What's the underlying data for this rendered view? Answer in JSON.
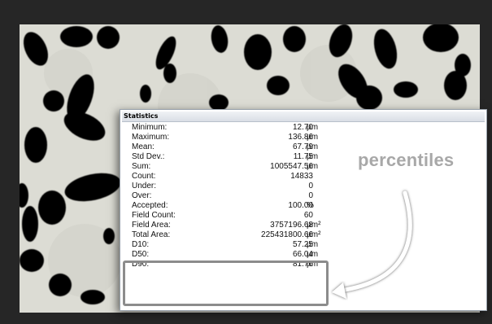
{
  "panel": {
    "title": "Statistics",
    "rows": [
      {
        "label": "Minimum:",
        "value": "12.70",
        "unit": "µm"
      },
      {
        "label": "Maximum:",
        "value": "136.86",
        "unit": "µm"
      },
      {
        "label": "Mean:",
        "value": "67.79",
        "unit": "µm"
      },
      {
        "label": "Std Dev.:",
        "value": "11.75",
        "unit": "µm"
      },
      {
        "label": "Sum:",
        "value": "1005547.56",
        "unit": "µm"
      },
      {
        "label": "Count:",
        "value": "14833",
        "unit": ""
      },
      {
        "label": "Under:",
        "value": "0",
        "unit": ""
      },
      {
        "label": "Over:",
        "value": "0",
        "unit": ""
      },
      {
        "label": "Accepted:",
        "value": "100.00",
        "unit": "%"
      },
      {
        "label": "Field Count:",
        "value": "60",
        "unit": ""
      },
      {
        "label": "Field Area:",
        "value": "3757196.68",
        "unit": "µm²"
      },
      {
        "label": "Total Area:",
        "value": "225431800.66",
        "unit": "µm²"
      },
      {
        "label": "D10:",
        "value": "57.25",
        "unit": "µm"
      },
      {
        "label": "D50:",
        "value": "66.04",
        "unit": "µm"
      },
      {
        "label": "D90:",
        "value": "81.76",
        "unit": "µm"
      }
    ]
  },
  "annotation": {
    "label": "percentiles",
    "color": "#a8a8a8"
  },
  "colors": {
    "frame": "#262626",
    "background": "#ddddd6",
    "particles": "#000000"
  }
}
